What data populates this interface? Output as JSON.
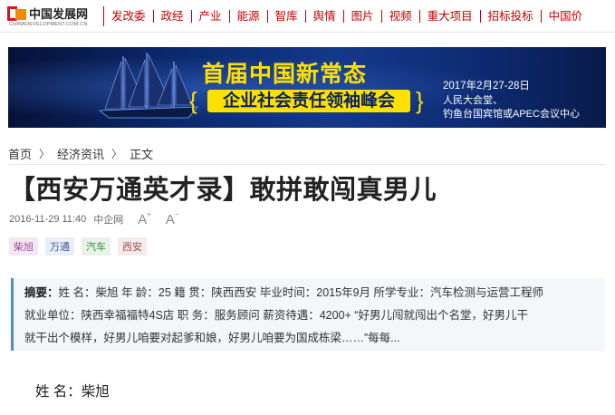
{
  "logo": {
    "name_cn": "中国发展网",
    "name_en": "CHINADEVELOPMENT.COM.CN"
  },
  "nav": {
    "items": [
      "发改委",
      "政经",
      "产业",
      "能源",
      "智库",
      "舆情",
      "图片",
      "视频",
      "重大项目",
      "招标投标",
      "中国价"
    ]
  },
  "banner": {
    "title_main": "首届中国新常态",
    "title_sub": "企业社会责任领袖峰会",
    "date": "2017年2月27-28日",
    "venue_line1": "人民大会堂、",
    "venue_line2": "钓鱼台国宾馆或APEC会议中心"
  },
  "breadcrumb": {
    "home": "首页",
    "section": "经济资讯",
    "current": "正文",
    "separator": "〉"
  },
  "article": {
    "title": "【西安万通英才录】敢拼敢闯真男儿",
    "datetime": "2016-11-29 11:40",
    "source": "中企网",
    "font_increase": "A",
    "font_decrease": "A",
    "tags": [
      "柴旭",
      "万通",
      "汽车",
      "西安"
    ],
    "summary_label": "摘要：",
    "summary_lines": [
      "姓 名：柴旭 年 龄：25 籍 贯：陕西西安 毕业时间：2015年9月 所学专业：汽车检测与运营工程师",
      "就业单位：陕西幸福福特4S店 职 务：服务顾问 薪资待遇：4200+ “好男儿闯就闯出个名堂，好男儿干",
      "就干出个模样，好男儿咱要对起爹和娘，好男儿咱要为国成栋梁……”每每..."
    ],
    "body_first_line": "姓 名：柴旭"
  },
  "colors": {
    "nav_red": "#c40000",
    "banner_yellow": "#ffe000",
    "banner_navy": "#0b2a6f",
    "summary_accent": "#4d8fc4"
  }
}
